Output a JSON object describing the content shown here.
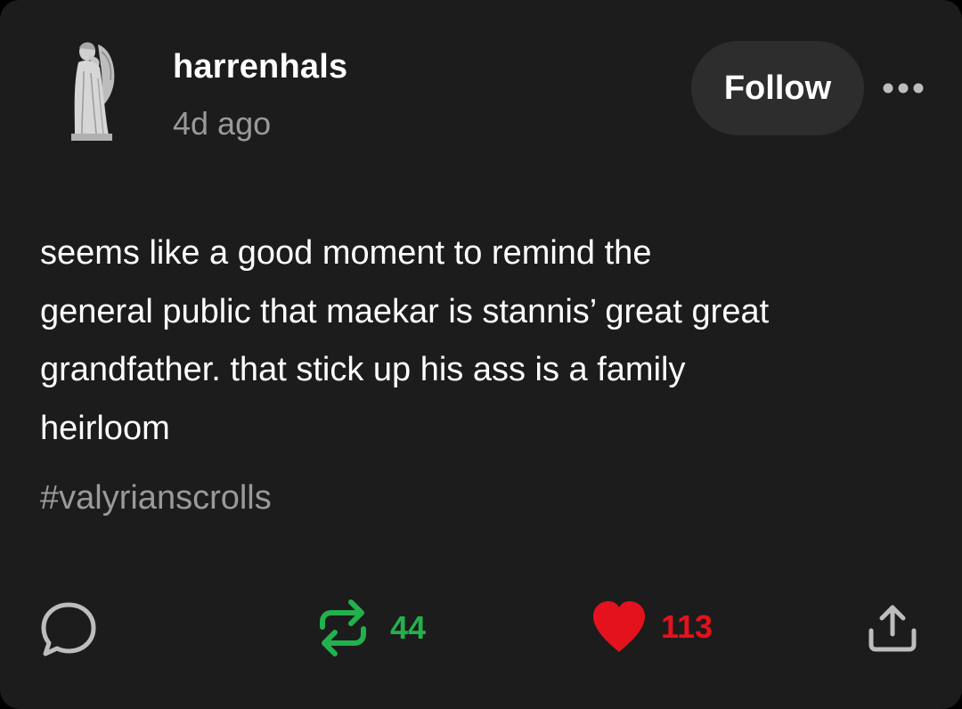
{
  "post": {
    "username": "harrenhals",
    "timestamp": "4d ago",
    "follow_label": "Follow",
    "body": "seems like a good moment to remind the\ngeneral public that maekar is stannis’ great great\ngrandfather. that stick up his ass is a family\nheirloom",
    "tag": "#valyrianscrolls"
  },
  "actions": {
    "reblog_count": "44",
    "like_count": "113"
  },
  "icons": {
    "avatar": "angel-statue-avatar",
    "more": "more-dots-icon",
    "reply": "reply-bubble-icon",
    "reblog": "reblog-icon",
    "like": "heart-icon",
    "share": "share-icon"
  },
  "colors": {
    "background": "#1c1c1c",
    "reblog": "#22b14c",
    "like": "#e4121c",
    "muted": "#9a9a9a"
  }
}
